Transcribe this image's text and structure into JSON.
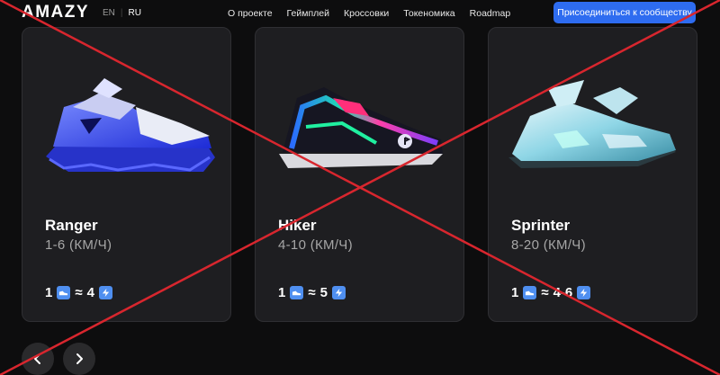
{
  "header": {
    "logo": "AMAZY",
    "languages": [
      "EN",
      "RU"
    ],
    "active_language": "RU",
    "nav": [
      "О проекте",
      "Геймплей",
      "Кроссовки",
      "Токеномика",
      "Roadmap"
    ],
    "join_button": "Присоединиться к сообществу"
  },
  "cards": [
    {
      "name": "Ranger",
      "speed": "1-6 (КМ/Ч)",
      "left": "1",
      "approx": "≈",
      "right": "4"
    },
    {
      "name": "Hiker",
      "speed": "4-10 (КМ/Ч)",
      "left": "1",
      "approx": "≈",
      "right": "5"
    },
    {
      "name": "Sprinter",
      "speed": "8-20 (КМ/Ч)",
      "left": "1",
      "approx": "≈",
      "right": "4-6"
    }
  ],
  "icons": {
    "shoe_badge": "shoe-icon",
    "energy_badge": "lightning-icon",
    "prev": "chevron-left-icon",
    "next": "chevron-right-icon"
  },
  "colors": {
    "background": "#0d0d0e",
    "card": "#1e1e21",
    "accent": "#2e6cf0",
    "badge": "#4f8ff0",
    "cross": "#d8262e"
  }
}
